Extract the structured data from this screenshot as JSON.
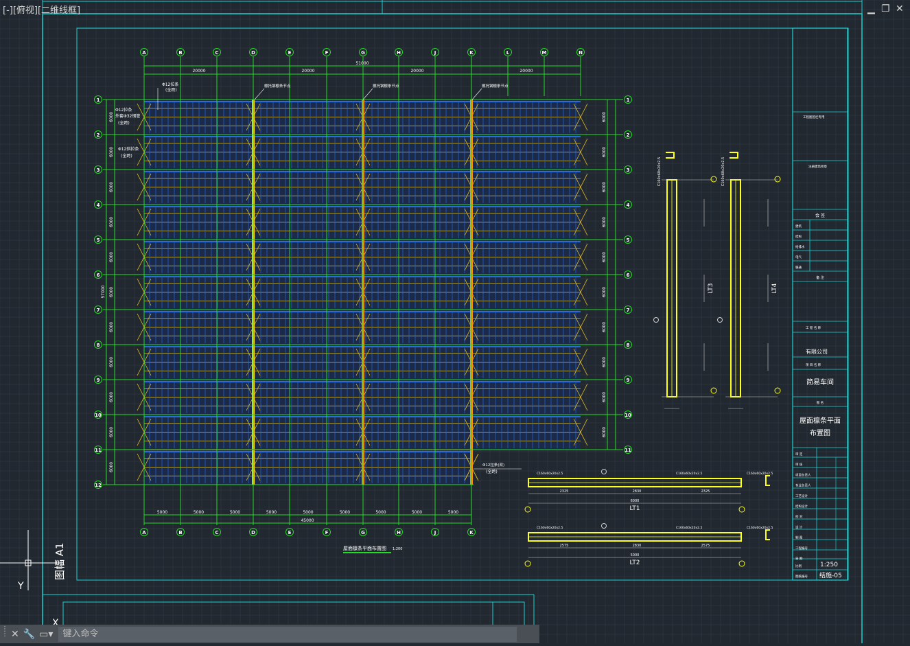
{
  "viewport": {
    "label": "[-][俯视][二维线框]",
    "sheet_size": "图幅 A1",
    "ucs_y": "Y",
    "ucs_x": "X"
  },
  "window_controls": {
    "minimize": "▁",
    "restore": "❐",
    "close": "✕"
  },
  "command_line": {
    "placeholder": "键入命令",
    "icons": [
      "close-icon",
      "wrench-icon",
      "command-history-icon"
    ]
  },
  "drawing": {
    "axis_cols_top": [
      "A",
      "B",
      "C",
      "D",
      "E",
      "F",
      "G",
      "H",
      "J",
      "K",
      "L",
      "M",
      "N"
    ],
    "axis_cols_bottom": [
      "A",
      "B",
      "C",
      "D",
      "E",
      "F",
      "G",
      "H",
      "J",
      "K"
    ],
    "axis_rows": [
      "1",
      "2",
      "3",
      "4",
      "5",
      "6",
      "7",
      "8",
      "9",
      "10",
      "11",
      "12"
    ],
    "overall_dim": "51000",
    "sub_dims_top": [
      "20000",
      "20000",
      "20000",
      "20000"
    ],
    "bottom_dims": [
      "5000",
      "5000",
      "5000",
      "5000",
      "5000",
      "5000",
      "5000",
      "5000",
      "5000"
    ],
    "bottom_total": "45000",
    "left_total": "57000",
    "row_dims": [
      "6000",
      "6000",
      "6000",
      "6000",
      "6000",
      "6000",
      "6000",
      "6000",
      "6000",
      "6000",
      "6000"
    ],
    "callouts": [
      "Φ12拉条",
      "(全跨)",
      "Φ12拉条",
      "外套Φ32钢管",
      "(全跨)",
      "Φ12斜拉条",
      "(全跨)",
      "Φ12拉条(双)",
      "(全跨)"
    ],
    "ridge_labels": [
      "檩托钢檩条节点",
      "檩托钢檩条节点",
      "檩托钢檩条节点"
    ],
    "plan_title": "屋面檩条平面布置图",
    "plan_scale": "1:200"
  },
  "details": {
    "lt3": "LT3",
    "lt4": "LT4",
    "lt1": "LT1",
    "lt2": "LT2",
    "purlin_spec": "C160x60x20x2.5",
    "dims_lt1": [
      "2325",
      "2830",
      "2325"
    ],
    "dims_lt2": [
      "2575",
      "2830",
      "2575"
    ],
    "len_lt1": "6000",
    "len_lt2": "5000"
  },
  "title_block": {
    "top_note": "工程图签栏专用",
    "stamp": "注册建筑师章",
    "sign_header": "会 签",
    "sign_rows": [
      "建筑",
      "结构",
      "给排水",
      "电气",
      "暖通"
    ],
    "remark": "备 注",
    "project_name_label": "工 程 名 称",
    "company": "有限公司",
    "subitem_label": "项 目 名 称",
    "subitem": "简易车间",
    "drawing_name_label": "图 名",
    "drawing_name_1": "屋面檩条平面",
    "drawing_name_2": "布置图",
    "approvals": [
      "审 定",
      "审 核",
      "项目负责人",
      "专业负责人",
      "工艺设计",
      "结构设计",
      "校 对",
      "设 计",
      "制 图",
      "工程编号",
      "日 期"
    ],
    "scale_label": "比例",
    "scale": "1:250",
    "no_label": "图纸编号",
    "drawing_no": "结施-05"
  },
  "colors": {
    "background": "#212830",
    "frame": "#19d4d4",
    "axis": "#22dd22",
    "purlin": "#e8c020",
    "purlin_blue": "#2a6cd8",
    "ridge": "#ff8c10",
    "detail": "#ffff20",
    "command_bar": "#4a4f55"
  }
}
